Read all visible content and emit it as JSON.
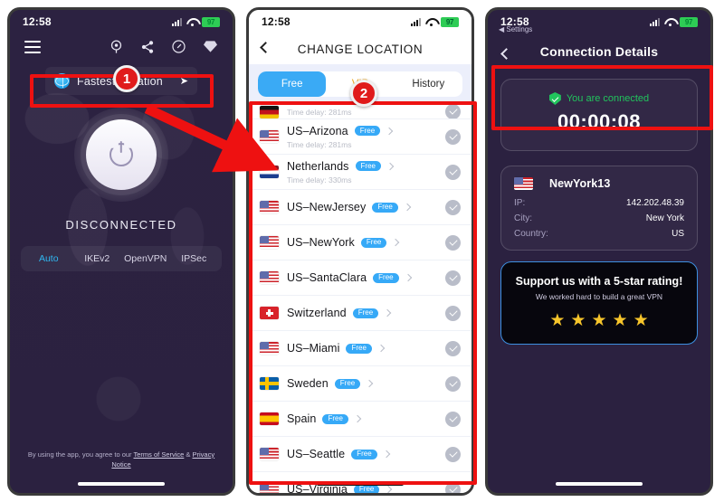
{
  "panels": {
    "home": {
      "status": {
        "time": "12:58",
        "battery": "97"
      },
      "toolbar_icons": [
        "menu-icon",
        "location-pin-icon",
        "share-icon",
        "speedometer-icon",
        "diamond-icon"
      ],
      "fastest_location": {
        "label": "Fastest Location",
        "caret": "➤"
      },
      "connection_status": "DISCONNECTED",
      "protocols": [
        {
          "label": "Auto",
          "active": true
        },
        {
          "label": "IKEv2",
          "active": false
        },
        {
          "label": "OpenVPN",
          "active": false
        },
        {
          "label": "IPSec",
          "active": false
        }
      ],
      "footer": {
        "prefix": "By using the app, you agree to our ",
        "terms": "Terms of Service",
        "amp": " & ",
        "privacy": "Privacy Notice"
      }
    },
    "location": {
      "status": {
        "time": "12:58",
        "battery": "97"
      },
      "title": "CHANGE LOCATION",
      "tabs": [
        {
          "label": "Free",
          "active": true
        },
        {
          "label": "VIP",
          "active": false
        },
        {
          "label": "History",
          "active": false
        }
      ],
      "partial_row": {
        "flag": "de",
        "delay": "Time delay: 281ms"
      },
      "rows": [
        {
          "name": "US–Arizona",
          "flag": "us",
          "badge": "Free",
          "delay": "Time delay: 281ms"
        },
        {
          "name": "Netherlands",
          "flag": "nl",
          "badge": "Free",
          "delay": "Time delay: 330ms"
        },
        {
          "name": "US–NewJersey",
          "flag": "us",
          "badge": "Free",
          "delay": ""
        },
        {
          "name": "US–NewYork",
          "flag": "us",
          "badge": "Free",
          "delay": ""
        },
        {
          "name": "US–SantaClara",
          "flag": "us",
          "badge": "Free",
          "delay": ""
        },
        {
          "name": "Switzerland",
          "flag": "ch",
          "badge": "Free",
          "delay": ""
        },
        {
          "name": "US–Miami",
          "flag": "us",
          "badge": "Free",
          "delay": ""
        },
        {
          "name": "Sweden",
          "flag": "se",
          "badge": "Free",
          "delay": ""
        },
        {
          "name": "Spain",
          "flag": "es",
          "badge": "Free",
          "delay": ""
        },
        {
          "name": "US–Seattle",
          "flag": "us",
          "badge": "Free",
          "delay": ""
        },
        {
          "name": "US–Virginia",
          "flag": "us",
          "badge": "Free",
          "delay": ""
        }
      ]
    },
    "connection": {
      "status": {
        "time": "12:58",
        "battery": "97",
        "back_app": "◀ Settings"
      },
      "title": "Connection Details",
      "connected_label": "You are connected",
      "timer": "00:00:08",
      "server": {
        "name": "NewYork13",
        "flag": "us",
        "fields": [
          {
            "key": "IP:",
            "value": "142.202.48.39"
          },
          {
            "key": "City:",
            "value": "New York"
          },
          {
            "key": "Country:",
            "value": "US"
          }
        ]
      },
      "rating": {
        "title": "Support us with a 5-star rating!",
        "subtitle": "We worked hard to build a great VPN",
        "stars": 5,
        "star_glyph": "★"
      }
    }
  },
  "annotations": {
    "badge_one": "1",
    "badge_two": "2"
  },
  "colors": {
    "accent_blue": "#36a9f7",
    "highlight_red": "#ee1111",
    "connected_green": "#21c45d",
    "vip_gold": "#f0a922",
    "star_gold": "#f7c52b",
    "dark_bg": "#2b2140"
  }
}
